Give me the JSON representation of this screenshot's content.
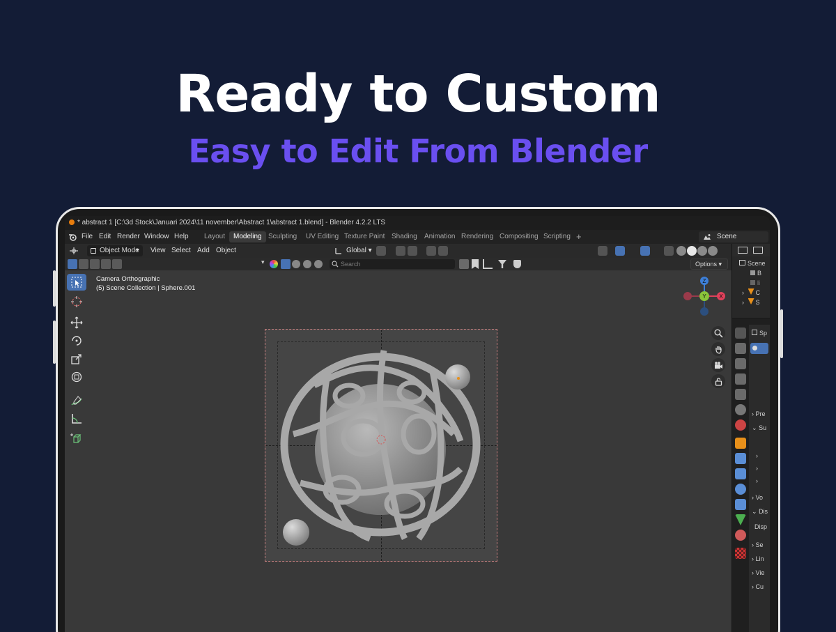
{
  "hero": {
    "title": "Ready to Custom",
    "subtitle": "Easy to Edit From Blender"
  },
  "window": {
    "title": "* abstract 1 [C:\\3d Stock\\Januari 2024\\11 november\\Abstract 1\\abstract 1.blend] - Blender 4.2.2 LTS"
  },
  "menu": [
    "File",
    "Edit",
    "Render",
    "Window",
    "Help"
  ],
  "workspaces": [
    "Layout",
    "Modeling",
    "Sculpting",
    "UV Editing",
    "Texture Paint",
    "Shading",
    "Animation",
    "Rendering",
    "Compositing",
    "Scripting"
  ],
  "active_workspace": "Modeling",
  "add_workspace": "+",
  "scene": {
    "label": "Scene"
  },
  "header": {
    "mode": "Object Mode",
    "view": "View",
    "select": "Select",
    "add": "Add",
    "object": "Object",
    "transform_orientation": "Global"
  },
  "toolbar2": {
    "search_placeholder": "Search",
    "options": "Options"
  },
  "viewport": {
    "camera_label": "Camera Orthographic",
    "collection_label": "(5) Scene Collection | Sphere.001"
  },
  "gizmo": {
    "z": "Z",
    "y": "Y",
    "x": "X"
  },
  "outliner": {
    "items": [
      "Scene",
      "B",
      "li",
      "C",
      "S"
    ]
  },
  "properties": {
    "rows": [
      "Sp",
      "Pre",
      "Su",
      "Vo",
      "Dis",
      "Disp",
      "Se",
      "Lin",
      "Vie",
      "Cu"
    ]
  },
  "colors": {
    "background": "#131c36",
    "subtitle": "#6a4ff0",
    "active_blue": "#4772b3",
    "axis_x": "#e0405a",
    "axis_y": "#8ac43a",
    "axis_z": "#3d7fd8"
  }
}
